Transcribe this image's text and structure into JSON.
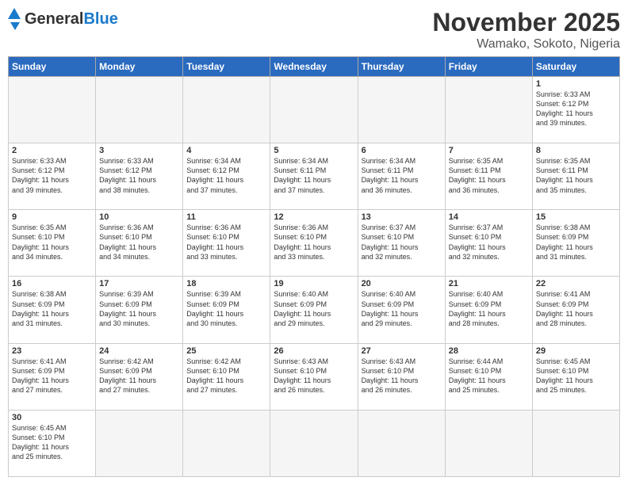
{
  "header": {
    "logo": {
      "general": "General",
      "blue": "Blue"
    },
    "title": "November 2025",
    "location": "Wamako, Sokoto, Nigeria"
  },
  "calendar": {
    "days_of_week": [
      "Sunday",
      "Monday",
      "Tuesday",
      "Wednesday",
      "Thursday",
      "Friday",
      "Saturday"
    ],
    "weeks": [
      [
        {
          "day": "",
          "info": ""
        },
        {
          "day": "",
          "info": ""
        },
        {
          "day": "",
          "info": ""
        },
        {
          "day": "",
          "info": ""
        },
        {
          "day": "",
          "info": ""
        },
        {
          "day": "",
          "info": ""
        },
        {
          "day": "1",
          "info": "Sunrise: 6:33 AM\nSunset: 6:12 PM\nDaylight: 11 hours\nand 39 minutes."
        }
      ],
      [
        {
          "day": "2",
          "info": "Sunrise: 6:33 AM\nSunset: 6:12 PM\nDaylight: 11 hours\nand 39 minutes."
        },
        {
          "day": "3",
          "info": "Sunrise: 6:33 AM\nSunset: 6:12 PM\nDaylight: 11 hours\nand 38 minutes."
        },
        {
          "day": "4",
          "info": "Sunrise: 6:34 AM\nSunset: 6:12 PM\nDaylight: 11 hours\nand 37 minutes."
        },
        {
          "day": "5",
          "info": "Sunrise: 6:34 AM\nSunset: 6:11 PM\nDaylight: 11 hours\nand 37 minutes."
        },
        {
          "day": "6",
          "info": "Sunrise: 6:34 AM\nSunset: 6:11 PM\nDaylight: 11 hours\nand 36 minutes."
        },
        {
          "day": "7",
          "info": "Sunrise: 6:35 AM\nSunset: 6:11 PM\nDaylight: 11 hours\nand 36 minutes."
        },
        {
          "day": "8",
          "info": "Sunrise: 6:35 AM\nSunset: 6:11 PM\nDaylight: 11 hours\nand 35 minutes."
        }
      ],
      [
        {
          "day": "9",
          "info": "Sunrise: 6:35 AM\nSunset: 6:10 PM\nDaylight: 11 hours\nand 34 minutes."
        },
        {
          "day": "10",
          "info": "Sunrise: 6:36 AM\nSunset: 6:10 PM\nDaylight: 11 hours\nand 34 minutes."
        },
        {
          "day": "11",
          "info": "Sunrise: 6:36 AM\nSunset: 6:10 PM\nDaylight: 11 hours\nand 33 minutes."
        },
        {
          "day": "12",
          "info": "Sunrise: 6:36 AM\nSunset: 6:10 PM\nDaylight: 11 hours\nand 33 minutes."
        },
        {
          "day": "13",
          "info": "Sunrise: 6:37 AM\nSunset: 6:10 PM\nDaylight: 11 hours\nand 32 minutes."
        },
        {
          "day": "14",
          "info": "Sunrise: 6:37 AM\nSunset: 6:10 PM\nDaylight: 11 hours\nand 32 minutes."
        },
        {
          "day": "15",
          "info": "Sunrise: 6:38 AM\nSunset: 6:09 PM\nDaylight: 11 hours\nand 31 minutes."
        }
      ],
      [
        {
          "day": "16",
          "info": "Sunrise: 6:38 AM\nSunset: 6:09 PM\nDaylight: 11 hours\nand 31 minutes."
        },
        {
          "day": "17",
          "info": "Sunrise: 6:39 AM\nSunset: 6:09 PM\nDaylight: 11 hours\nand 30 minutes."
        },
        {
          "day": "18",
          "info": "Sunrise: 6:39 AM\nSunset: 6:09 PM\nDaylight: 11 hours\nand 30 minutes."
        },
        {
          "day": "19",
          "info": "Sunrise: 6:40 AM\nSunset: 6:09 PM\nDaylight: 11 hours\nand 29 minutes."
        },
        {
          "day": "20",
          "info": "Sunrise: 6:40 AM\nSunset: 6:09 PM\nDaylight: 11 hours\nand 29 minutes."
        },
        {
          "day": "21",
          "info": "Sunrise: 6:40 AM\nSunset: 6:09 PM\nDaylight: 11 hours\nand 28 minutes."
        },
        {
          "day": "22",
          "info": "Sunrise: 6:41 AM\nSunset: 6:09 PM\nDaylight: 11 hours\nand 28 minutes."
        }
      ],
      [
        {
          "day": "23",
          "info": "Sunrise: 6:41 AM\nSunset: 6:09 PM\nDaylight: 11 hours\nand 27 minutes."
        },
        {
          "day": "24",
          "info": "Sunrise: 6:42 AM\nSunset: 6:09 PM\nDaylight: 11 hours\nand 27 minutes."
        },
        {
          "day": "25",
          "info": "Sunrise: 6:42 AM\nSunset: 6:10 PM\nDaylight: 11 hours\nand 27 minutes."
        },
        {
          "day": "26",
          "info": "Sunrise: 6:43 AM\nSunset: 6:10 PM\nDaylight: 11 hours\nand 26 minutes."
        },
        {
          "day": "27",
          "info": "Sunrise: 6:43 AM\nSunset: 6:10 PM\nDaylight: 11 hours\nand 26 minutes."
        },
        {
          "day": "28",
          "info": "Sunrise: 6:44 AM\nSunset: 6:10 PM\nDaylight: 11 hours\nand 25 minutes."
        },
        {
          "day": "29",
          "info": "Sunrise: 6:45 AM\nSunset: 6:10 PM\nDaylight: 11 hours\nand 25 minutes."
        }
      ],
      [
        {
          "day": "30",
          "info": "Sunrise: 6:45 AM\nSunset: 6:10 PM\nDaylight: 11 hours\nand 25 minutes."
        },
        {
          "day": "",
          "info": ""
        },
        {
          "day": "",
          "info": ""
        },
        {
          "day": "",
          "info": ""
        },
        {
          "day": "",
          "info": ""
        },
        {
          "day": "",
          "info": ""
        },
        {
          "day": "",
          "info": ""
        }
      ]
    ]
  }
}
